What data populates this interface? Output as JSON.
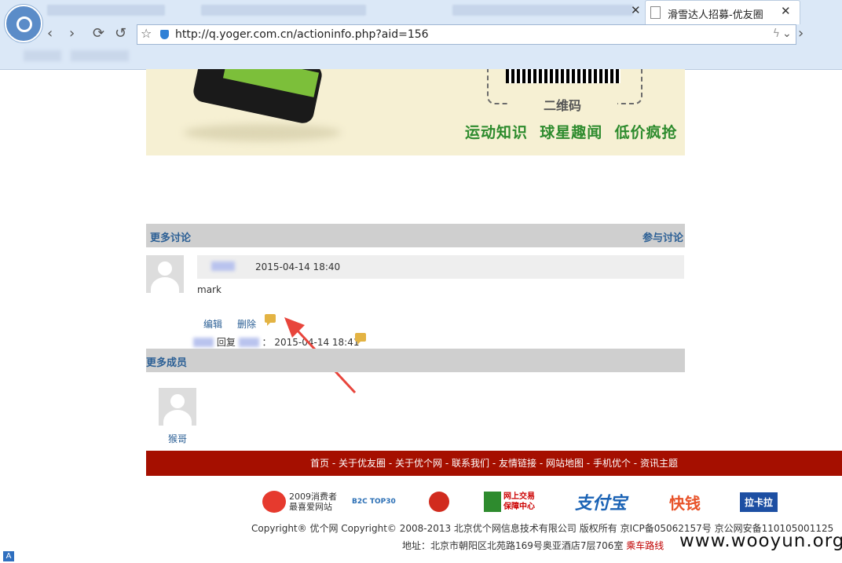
{
  "browser": {
    "tab_title": "滑雪达人招募-优友圈",
    "tab_close": "✕",
    "url": "http://q.yoger.com.cn/actioninfo.php?aid=156",
    "nav": {
      "back": "‹",
      "forward": "›",
      "reload": "⟳",
      "undo": "↺",
      "star": "☆",
      "bolt": "ϟ",
      "dropdown": "⌄",
      "next": "›"
    }
  },
  "banner": {
    "qr_label": "二维码",
    "slogans": [
      "运动知识",
      "球星趣闻",
      "低价疯抢"
    ]
  },
  "discussion": {
    "header_left": "更多讨论",
    "header_right": "参与讨论",
    "post": {
      "time": "2015-04-14 18:40",
      "body": "mark",
      "edit": "编辑",
      "delete": "删除",
      "reply_text": "回复",
      "reply_sep": "：",
      "reply_time": "2015-04-14 18:41"
    }
  },
  "members": {
    "header": "更多成员",
    "list": [
      {
        "name": "猴哥"
      }
    ]
  },
  "footer": {
    "nav": [
      "首页",
      "关于优友圈",
      "关于优个网",
      "联系我们",
      "友情链接",
      "网站地图",
      "手机优个",
      "资讯主题"
    ],
    "badges": {
      "consumer": "2009消费者",
      "consumer2": "最喜爱网站",
      "b2c": "B2C TOP30",
      "trade": "网上交易",
      "trade2": "保障中心",
      "alipay": "支付宝",
      "kuaiqian": "快钱",
      "lakala": "拉卡拉"
    },
    "copyright": "Copyright® 优个网 Copyright© 2008-2013 北京优个网信息技术有限公司 版权所有 京ICP备05062157号 京公网安备110105001125",
    "address": "地址：北京市朝阳区北苑路169号奥亚酒店7层706室",
    "route": "乘车路线"
  },
  "watermark": "www.wooyun.org",
  "colors": {
    "accent_green": "#2d8b2d",
    "link_blue": "#2b5f95",
    "footer_red": "#a50f00",
    "bar_gray": "#cfcfcf"
  }
}
